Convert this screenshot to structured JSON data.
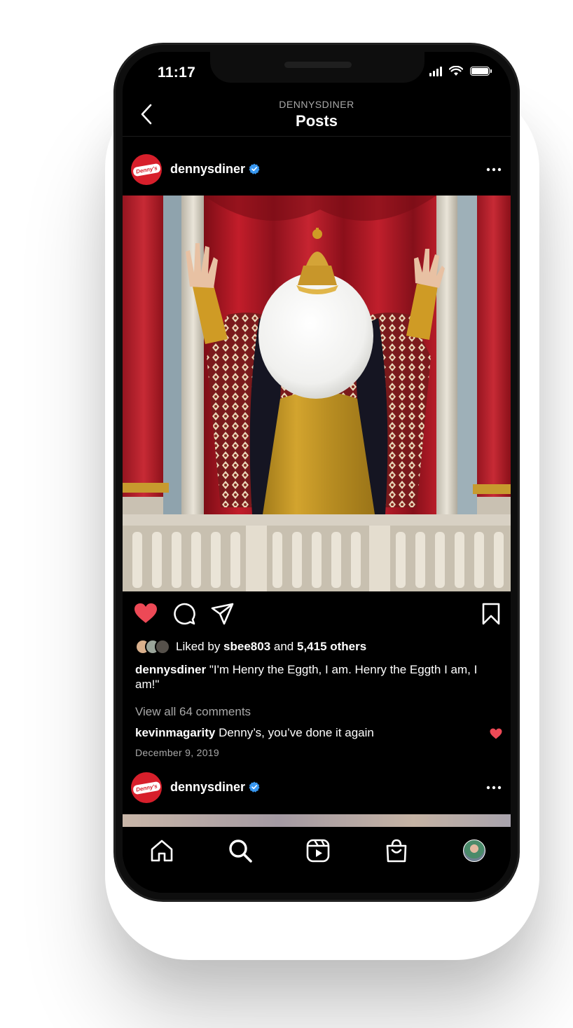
{
  "status_bar": {
    "time": "11:17"
  },
  "header": {
    "subtitle": "DENNYSDINER",
    "title": "Posts"
  },
  "post": {
    "author": "dennysdiner",
    "logo_text": "Denny's",
    "liked_by_prefix": "Liked by ",
    "liked_by_user": "sbee803",
    "liked_by_middle": " and ",
    "liked_by_count": "5,415 others",
    "caption_user": "dennysdiner",
    "caption_text": " \"I'm Henry the Eggth, I am. Henry the Eggth I am, I am!\"",
    "view_comments": "View all 64 comments",
    "comment_user": "kevinmagarity",
    "comment_text": " Denny’s, you’ve done it again",
    "date": "December 9, 2019"
  },
  "next_post": {
    "author": "dennysdiner",
    "logo_text": "Denny's"
  },
  "icons": {
    "back": "chevron-left-icon",
    "verified": "verified-badge-icon",
    "more": "more-horizontal-icon",
    "like": "heart-filled-icon",
    "comment": "comment-icon",
    "share": "send-icon",
    "save": "bookmark-icon",
    "home": "home-icon",
    "search": "search-icon",
    "reels": "reels-icon",
    "shop": "shop-bag-icon",
    "profile": "profile-avatar"
  },
  "colors": {
    "like": "#ed4956",
    "verified": "#3897f0",
    "brand": "#d71f2b"
  }
}
